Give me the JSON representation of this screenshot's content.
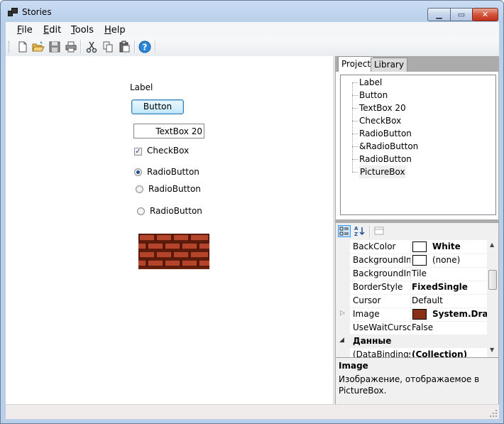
{
  "window": {
    "title": "Stories"
  },
  "menu": [
    {
      "prefix": "",
      "accel": "F",
      "rest": "ile"
    },
    {
      "prefix": "",
      "accel": "E",
      "rest": "dit"
    },
    {
      "prefix": "",
      "accel": "T",
      "rest": "ools"
    },
    {
      "prefix": "",
      "accel": "H",
      "rest": "elp"
    }
  ],
  "toolbar": {
    "buttons": [
      "new-icon",
      "open-icon",
      "save-icon",
      "print-icon",
      "cut-icon",
      "copy-icon",
      "paste-icon",
      "help-icon"
    ]
  },
  "design": {
    "label": "Label",
    "button": "Button",
    "textbox": "TextBox 20",
    "checkbox": "CheckBox",
    "checkbox_checked": true,
    "radio1": "RadioButton",
    "radio2": "RadioButton",
    "radio3": "RadioButton",
    "radio_selected": 1
  },
  "tabs": [
    "Project",
    "Library"
  ],
  "tree": [
    "Label",
    "Button",
    "TextBox 20",
    "CheckBox",
    "RadioButton",
    "&RadioButton",
    "RadioButton",
    "PictureBox"
  ],
  "properties": [
    {
      "name": "BackColor",
      "value": "White",
      "swatch": "white",
      "bold": true
    },
    {
      "name": "BackgroundIm",
      "value": "(none)",
      "swatch": "white",
      "bold": false
    },
    {
      "name": "BackgroundIm",
      "value": "Tile",
      "swatch": "",
      "bold": false
    },
    {
      "name": "BorderStyle",
      "value": "FixedSingle",
      "swatch": "",
      "bold": true
    },
    {
      "name": "Cursor",
      "value": "Default",
      "swatch": "",
      "bold": false
    },
    {
      "name": "Image",
      "value": "System.Drawi",
      "swatch": "brick",
      "bold": true,
      "expandable": true
    },
    {
      "name": "UseWaitCursor",
      "value": "False",
      "swatch": "",
      "bold": false
    }
  ],
  "category": "Данные",
  "last_row": {
    "name": "(DataBindings)",
    "value": "(Collection)"
  },
  "help": {
    "title": "Image",
    "description": "Изображение, отображаемое в PictureBox."
  },
  "colors": {
    "accent": "#3c7fb1",
    "brick": "#7a2712",
    "selection": "#3399ff"
  }
}
